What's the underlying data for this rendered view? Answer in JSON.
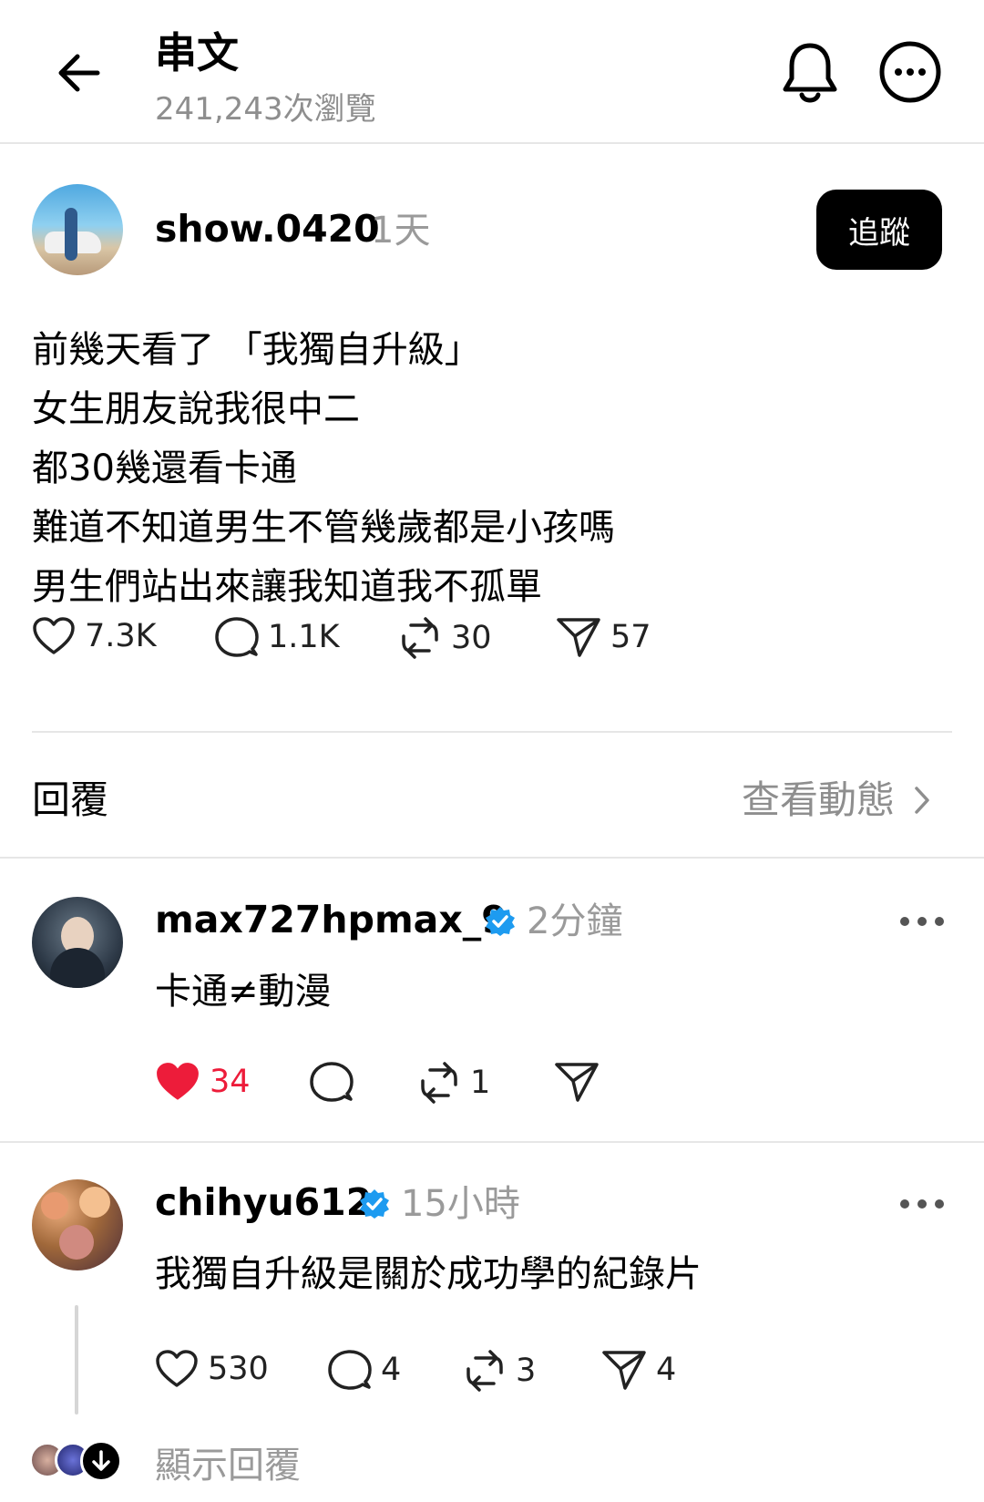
{
  "header": {
    "title": "串文",
    "views": "241,243次瀏覽"
  },
  "post": {
    "username": "show.0420",
    "time": "1天",
    "follow_label": "追蹤",
    "lines": [
      "前幾天看了 「我獨自升級」",
      "女生朋友說我很中二",
      "都30幾還看卡通",
      "難道不知道男生不管幾歲都是小孩嗎",
      "男生們站出來讓我知道我不孤單"
    ],
    "likes": "7.3K",
    "comments": "1.1K",
    "reposts": "30",
    "shares": "57"
  },
  "replies_bar": {
    "label": "回覆",
    "activity_link": "查看動態"
  },
  "comments": [
    {
      "username": "max727hpmax_9",
      "verified": true,
      "time": "2分鐘",
      "text": "卡通≠動漫",
      "likes": "34",
      "liked": true,
      "comments": "",
      "reposts": "1",
      "shares": ""
    },
    {
      "username": "chihyu612",
      "verified": true,
      "time": "15小時",
      "text": "我獨自升級是關於成功學的紀錄片",
      "likes": "530",
      "liked": false,
      "comments": "4",
      "reposts": "3",
      "shares": "4"
    }
  ],
  "show_replies_label": "顯示回覆",
  "colors": {
    "like_active": "#ed1c3a",
    "verified": "#1d9bf0",
    "muted_text": "#8e8e8e"
  }
}
